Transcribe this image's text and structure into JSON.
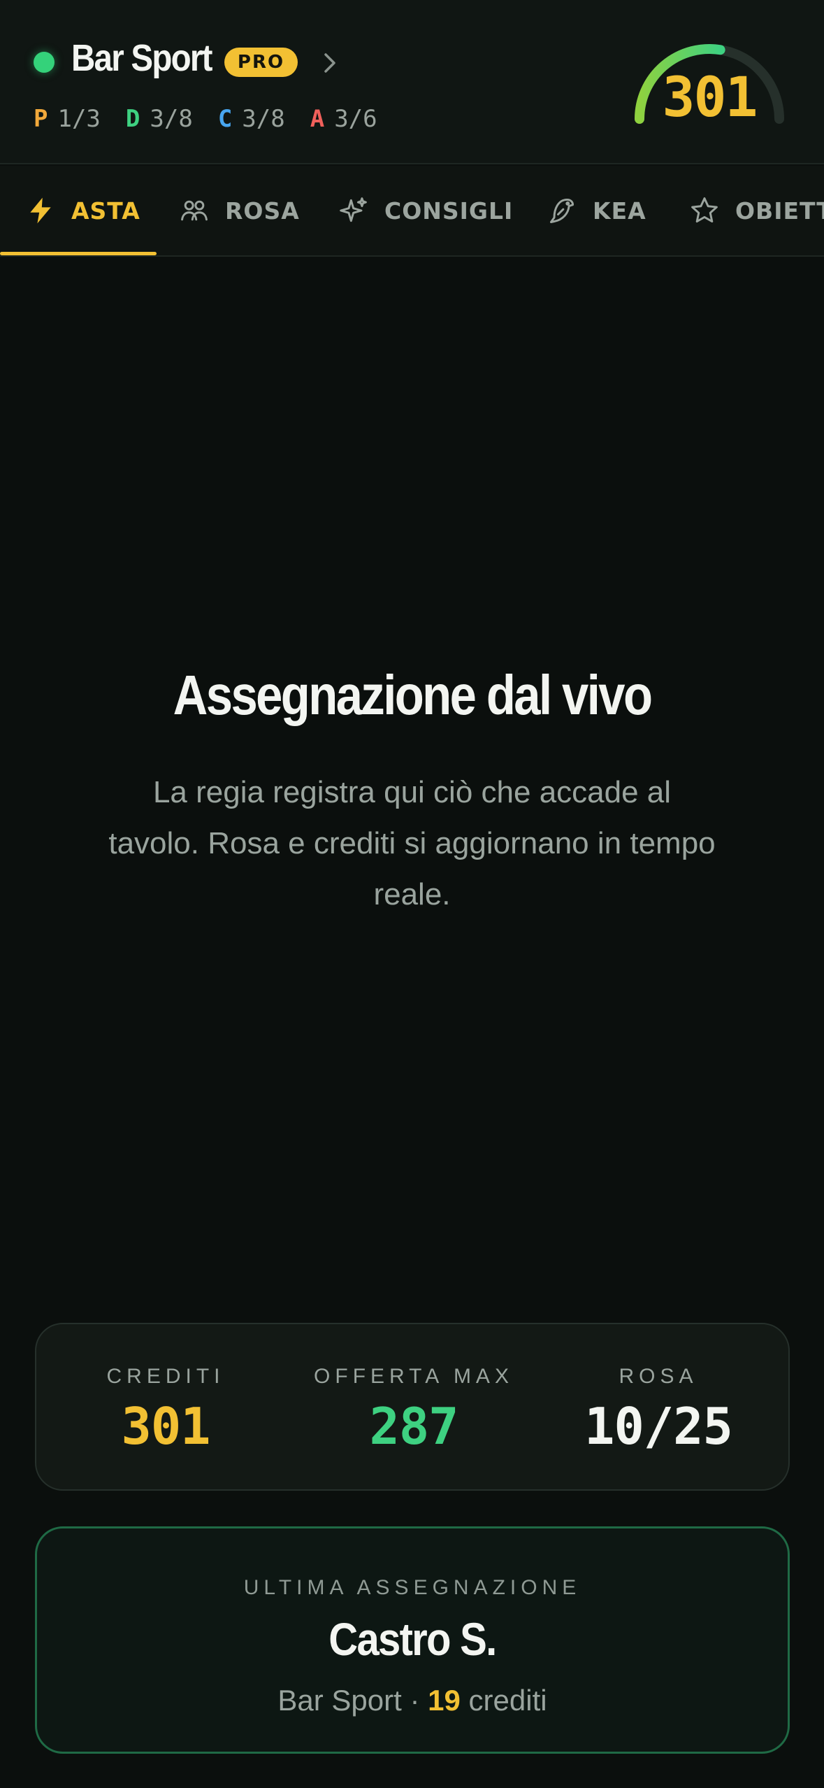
{
  "header": {
    "team_name": "Bar Sport",
    "plan_badge": "PRO",
    "credits": "301",
    "credits_fraction": 0.55,
    "colors": {
      "accent": "#f2c033",
      "online": "#34d27a",
      "gauge_start": "#8fd13f",
      "gauge_end": "#3ed181"
    },
    "roles": [
      {
        "letter": "P",
        "value": "1/3",
        "color": "#f2a93b"
      },
      {
        "letter": "D",
        "value": "3/8",
        "color": "#3ed181"
      },
      {
        "letter": "C",
        "value": "3/8",
        "color": "#48a6f0"
      },
      {
        "letter": "A",
        "value": "3/6",
        "color": "#f0605b"
      }
    ]
  },
  "tabs": [
    {
      "label": "ASTA",
      "icon": "lightning-icon",
      "active": true
    },
    {
      "label": "ROSA",
      "icon": "users-icon",
      "active": false
    },
    {
      "label": "CONSIGLI",
      "icon": "sparkle-icon",
      "active": false
    },
    {
      "label": "KEA",
      "icon": "bird-icon",
      "active": false
    },
    {
      "label": "OBIETT",
      "icon": "star-icon",
      "active": false
    }
  ],
  "hero": {
    "title": "Assegnazione dal vivo",
    "subtitle": "La regia registra qui ciò che accade al tavolo. Rosa e crediti si aggiornano in tempo reale."
  },
  "stats": {
    "credits_label": "CREDITI",
    "credits_value": "301",
    "max_offer_label": "OFFERTA MAX",
    "max_offer_value": "287",
    "roster_label": "ROSA",
    "roster_value": "10/25"
  },
  "last_assignment": {
    "label": "ULTIMA ASSEGNAZIONE",
    "player": "Castro S.",
    "team": "Bar Sport",
    "separator": "·",
    "amount": "19",
    "unit": "crediti"
  }
}
